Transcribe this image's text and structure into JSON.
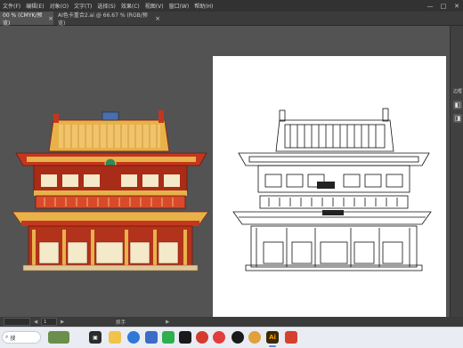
{
  "menubar": {
    "items": [
      "文件(F)",
      "编辑(E)",
      "对象(O)",
      "文字(T)",
      "选择(S)",
      "效果(C)",
      "视图(V)",
      "窗口(W)",
      "帮助(H)"
    ],
    "controls": {
      "minimize": "—",
      "maximize": "□",
      "close": "✕"
    }
  },
  "tabs": [
    {
      "label": "00 % (CMYK/预览)",
      "close": "×"
    },
    {
      "label": "AI色卡重合2.ai @ 66.67 % (RGB/预览)",
      "close": "×"
    }
  ],
  "rightpanel": {
    "label": "边框"
  },
  "statusbar": {
    "zoom": "",
    "page": "1",
    "tool": "抓手"
  },
  "taskbar": {
    "search_placeholder": "搜",
    "icons": [
      "task-view",
      "file-explorer",
      "edge-browser",
      "store",
      "wechat",
      "capcut",
      "netease-music",
      "qq",
      "illustrator",
      "wps"
    ],
    "illustrator_label": "Ai"
  },
  "colors": {
    "accent": "#5b8bd9",
    "illustrator": "#ff9a00",
    "building_red": "#c4361e",
    "building_gold": "#e8b24a"
  }
}
